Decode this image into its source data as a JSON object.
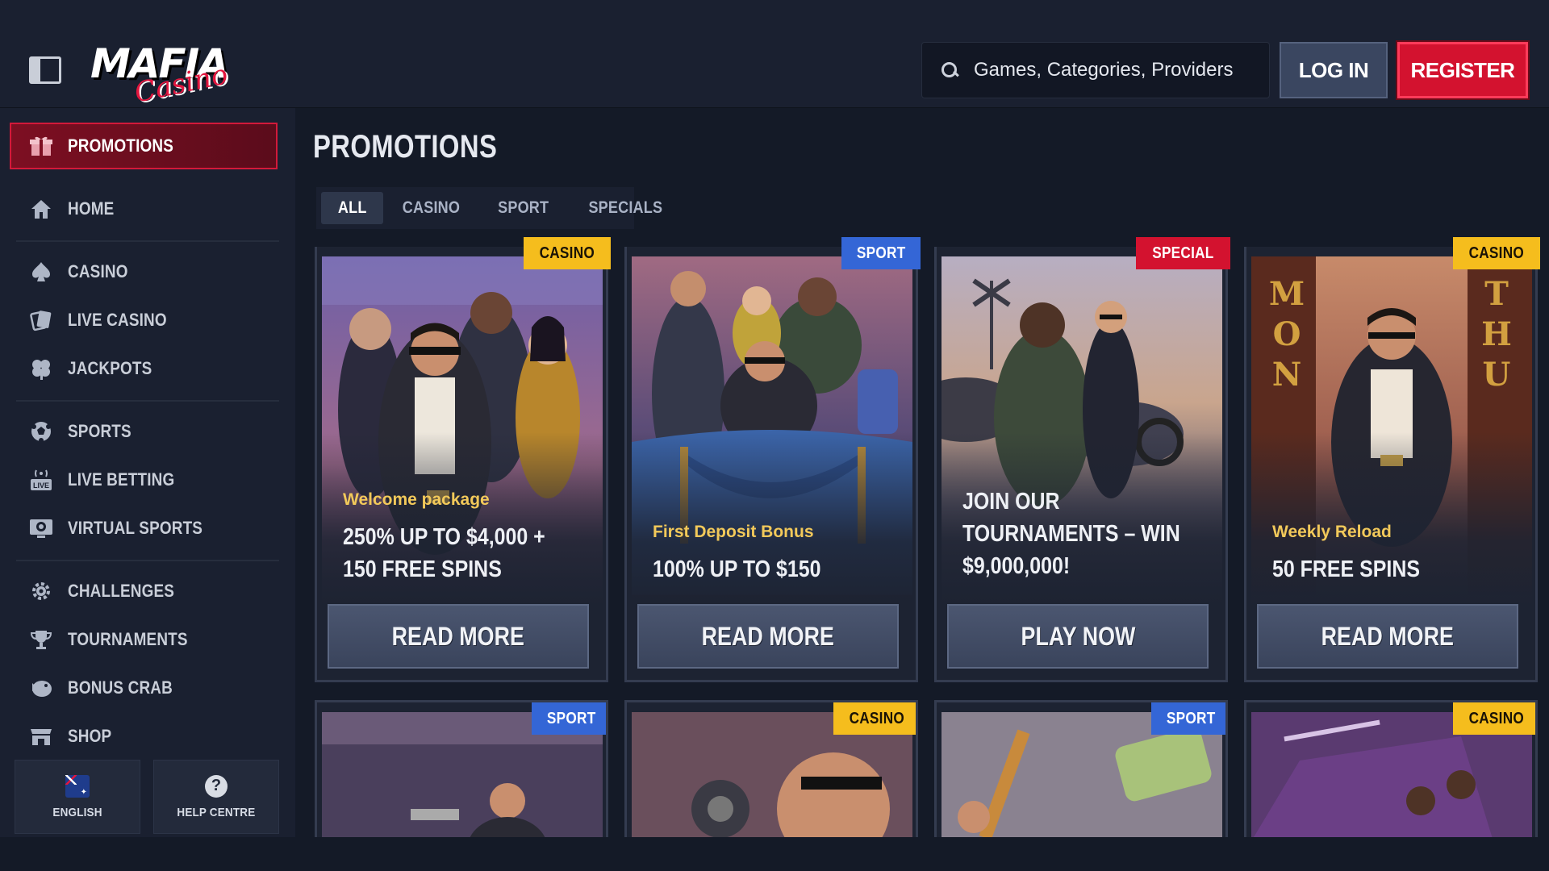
{
  "header": {
    "logo_main": "MAFIA",
    "logo_script": "Casino",
    "search_placeholder": "Games, Categories, Providers",
    "login_label": "LOG IN",
    "register_label": "REGISTER"
  },
  "sidebar": {
    "promotions_label": "PROMOTIONS",
    "items": [
      {
        "label": "HOME",
        "icon": "home-icon"
      },
      {
        "label": "CASINO",
        "icon": "spade-icon"
      },
      {
        "label": "LIVE CASINO",
        "icon": "cards-icon"
      },
      {
        "label": "JACKPOTS",
        "icon": "clover-icon"
      },
      {
        "label": "SPORTS",
        "icon": "soccer-ball-icon"
      },
      {
        "label": "LIVE BETTING",
        "icon": "live-icon"
      },
      {
        "label": "VIRTUAL SPORTS",
        "icon": "virtual-sports-icon"
      },
      {
        "label": "CHALLENGES",
        "icon": "gear-badge-icon"
      },
      {
        "label": "TOURNAMENTS",
        "icon": "trophy-icon"
      },
      {
        "label": "BONUS CRAB",
        "icon": "crab-icon"
      },
      {
        "label": "SHOP",
        "icon": "shop-icon"
      }
    ],
    "language_label": "ENGLISH",
    "help_label": "HELP CENTRE"
  },
  "main": {
    "title": "PROMOTIONS",
    "filters": [
      "ALL",
      "CASINO",
      "SPORT",
      "SPECIALS"
    ],
    "active_filter": "ALL",
    "cards": [
      {
        "badge": "CASINO",
        "subtitle": "Welcome package",
        "title_line1": "250% UP TO $4,000 +",
        "title_line2": "150 FREE SPINS",
        "button": "READ MORE"
      },
      {
        "badge": "SPORT",
        "subtitle": "First Deposit Bonus",
        "title_line1": "100% UP TO $150",
        "title_line2": "",
        "button": "READ MORE"
      },
      {
        "badge": "SPECIAL",
        "subtitle": "",
        "title_line1": "JOIN OUR",
        "title_line2": "TOURNAMENTS – WIN",
        "title_line3": "$9,000,000!",
        "button": "PLAY NOW"
      },
      {
        "badge": "CASINO",
        "subtitle": "Weekly Reload",
        "title_line1": "50 FREE SPINS",
        "title_line2": "",
        "button": "READ MORE",
        "door_left": "MON",
        "door_right": "THU"
      }
    ],
    "lower_cards": [
      {
        "badge": "SPORT"
      },
      {
        "badge": "CASINO"
      },
      {
        "badge": "SPORT"
      },
      {
        "badge": "CASINO"
      }
    ]
  },
  "colors": {
    "background": "#141a27",
    "panel": "#1a2030",
    "accent_red": "#d3122f",
    "badge_casino": "#f5bd1d",
    "badge_sport": "#3466d6",
    "badge_special": "#d3122f"
  }
}
